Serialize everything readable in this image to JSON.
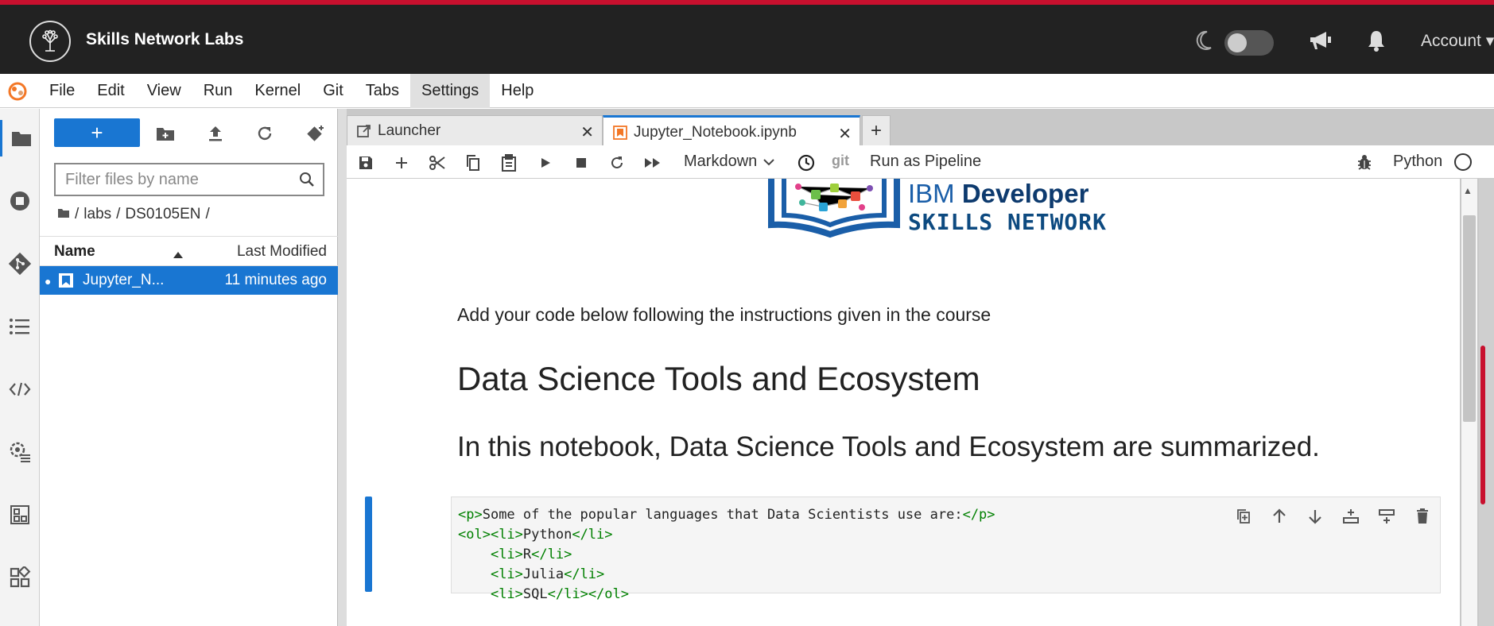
{
  "header": {
    "brand": "Skills Network Labs",
    "account_label": "Account"
  },
  "menu": {
    "items": [
      "File",
      "Edit",
      "View",
      "Run",
      "Kernel",
      "Git",
      "Tabs",
      "Settings",
      "Help"
    ],
    "active": "Settings"
  },
  "filebrowser": {
    "filter_placeholder": "Filter files by name",
    "breadcrumb": [
      "labs",
      "DS0105EN"
    ],
    "col_name": "Name",
    "col_modified": "Last Modified",
    "files": [
      {
        "name": "Jupyter_N...",
        "modified": "11 minutes ago",
        "selected": true
      }
    ]
  },
  "tabs": [
    {
      "label": "Launcher",
      "active": false
    },
    {
      "label": "Jupyter_Notebook.ipynb",
      "active": true
    }
  ],
  "toolbar": {
    "cell_type": "Markdown",
    "git_label": "git",
    "pipeline_label": "Run as Pipeline",
    "kernel_name": "Python"
  },
  "notebook": {
    "logo_line1_prefix": "IBM ",
    "logo_line1_bold": "Developer",
    "logo_line2": "SKILLS NETWORK",
    "paragraph": "Add your code below following the instructions given in the course",
    "heading1": "Data Science Tools and Ecosystem",
    "heading2": "In this notebook, Data Science Tools and Ecosystem are summarized.",
    "active_cell_source": [
      "<p>Some of the popular languages that Data Scientists use are:</p>",
      "<ol><li>Python</li>",
      "    <li>R</li>",
      "    <li>Julia</li>",
      "    <li>SQL</li></ol>"
    ]
  },
  "colors": {
    "accent": "#1976d2",
    "header_bg": "#222222",
    "top_stripe": "#c8102e"
  }
}
